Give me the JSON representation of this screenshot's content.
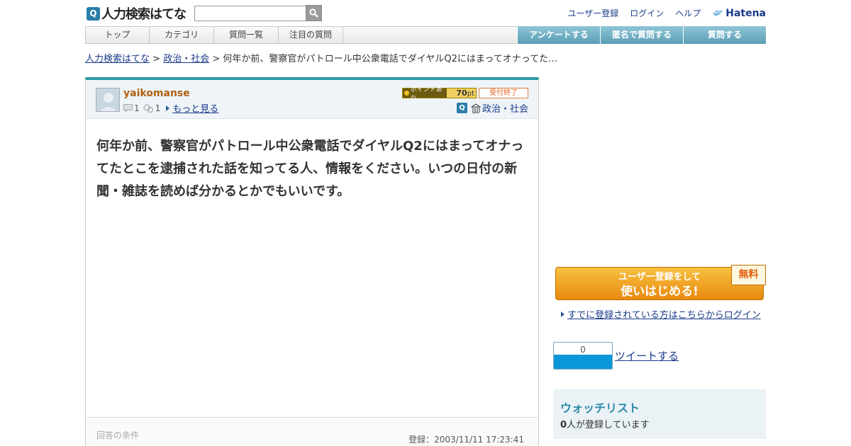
{
  "header": {
    "logo_text": "人力検索はてな",
    "search_placeholder": "",
    "links": [
      "ユーザー登録",
      "ログイン",
      "ヘルプ"
    ],
    "hatena_label": "Hatena"
  },
  "nav": {
    "left": [
      "トップ",
      "カテゴリ",
      "質問一覧",
      "注目の質問"
    ],
    "right": [
      "アンケートする",
      "匿名で質問する",
      "質問する"
    ]
  },
  "breadcrumb": {
    "home": "人力検索はてな",
    "sep1": ">",
    "category": "政治・社会",
    "sep2": ">",
    "current": "何年か前、警察官がパトロール中公衆電話でダイヤルQ2にはまってオナってた…"
  },
  "question": {
    "username": "yaikomanse",
    "stat1": "1",
    "stat2": "1",
    "more_link": "もっと見る",
    "points_label": "ポイントあり",
    "points_value": "70",
    "points_unit": "pt",
    "status": "受付終了",
    "category": "政治・社会",
    "body": "何年か前、警察官がパトロール中公衆電話でダイヤルQ2にはまってオナってたとこを逮捕された話を知ってる人、情報をください。いつの日付の新聞・雑誌を読めば分かるとかでもいいです。",
    "conditions_label": "回答の条件",
    "registered": "登録：2003/11/11 17:23:41"
  },
  "sidebar": {
    "signup_line1": "ユーザー登録をして",
    "signup_line2": "使いはじめる!",
    "free_badge": "無料",
    "login_link": "すでに登録されている方はこちらからログイン",
    "tweet_count": "0",
    "tweet_link": "ツイートする",
    "watchlist_title": "ウォッチリスト",
    "watch_count": "0",
    "watch_text": "人が登録しています"
  },
  "colors": {
    "accent": "#2c9aa8",
    "nav_blue": "#5a9eb5",
    "signup_orange": "#e88a10",
    "username": "#b06010"
  }
}
